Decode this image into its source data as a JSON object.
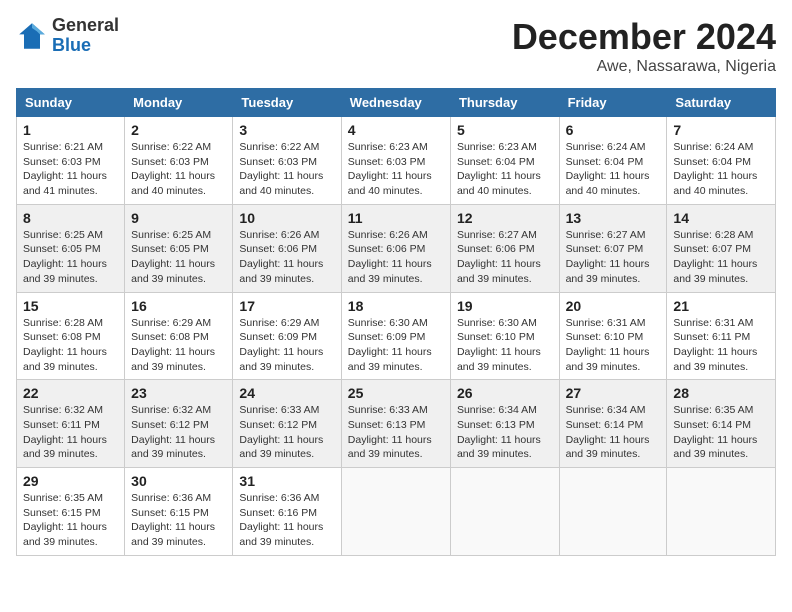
{
  "header": {
    "logo_general": "General",
    "logo_blue": "Blue",
    "month_title": "December 2024",
    "location": "Awe, Nassarawa, Nigeria"
  },
  "calendar": {
    "days_of_week": [
      "Sunday",
      "Monday",
      "Tuesday",
      "Wednesday",
      "Thursday",
      "Friday",
      "Saturday"
    ],
    "weeks": [
      [
        {
          "day": "",
          "info": ""
        },
        {
          "day": "",
          "info": ""
        },
        {
          "day": "",
          "info": ""
        },
        {
          "day": "",
          "info": ""
        },
        {
          "day": "",
          "info": ""
        },
        {
          "day": "",
          "info": ""
        },
        {
          "day": "",
          "info": ""
        }
      ]
    ]
  },
  "cells": {
    "w1": [
      {
        "num": "1",
        "rise": "Sunrise: 6:21 AM",
        "set": "Sunset: 6:03 PM",
        "daylight": "Daylight: 11 hours and 41 minutes."
      },
      {
        "num": "2",
        "rise": "Sunrise: 6:22 AM",
        "set": "Sunset: 6:03 PM",
        "daylight": "Daylight: 11 hours and 40 minutes."
      },
      {
        "num": "3",
        "rise": "Sunrise: 6:22 AM",
        "set": "Sunset: 6:03 PM",
        "daylight": "Daylight: 11 hours and 40 minutes."
      },
      {
        "num": "4",
        "rise": "Sunrise: 6:23 AM",
        "set": "Sunset: 6:03 PM",
        "daylight": "Daylight: 11 hours and 40 minutes."
      },
      {
        "num": "5",
        "rise": "Sunrise: 6:23 AM",
        "set": "Sunset: 6:04 PM",
        "daylight": "Daylight: 11 hours and 40 minutes."
      },
      {
        "num": "6",
        "rise": "Sunrise: 6:24 AM",
        "set": "Sunset: 6:04 PM",
        "daylight": "Daylight: 11 hours and 40 minutes."
      },
      {
        "num": "7",
        "rise": "Sunrise: 6:24 AM",
        "set": "Sunset: 6:04 PM",
        "daylight": "Daylight: 11 hours and 40 minutes."
      }
    ],
    "w2": [
      {
        "num": "8",
        "rise": "Sunrise: 6:25 AM",
        "set": "Sunset: 6:05 PM",
        "daylight": "Daylight: 11 hours and 39 minutes."
      },
      {
        "num": "9",
        "rise": "Sunrise: 6:25 AM",
        "set": "Sunset: 6:05 PM",
        "daylight": "Daylight: 11 hours and 39 minutes."
      },
      {
        "num": "10",
        "rise": "Sunrise: 6:26 AM",
        "set": "Sunset: 6:06 PM",
        "daylight": "Daylight: 11 hours and 39 minutes."
      },
      {
        "num": "11",
        "rise": "Sunrise: 6:26 AM",
        "set": "Sunset: 6:06 PM",
        "daylight": "Daylight: 11 hours and 39 minutes."
      },
      {
        "num": "12",
        "rise": "Sunrise: 6:27 AM",
        "set": "Sunset: 6:06 PM",
        "daylight": "Daylight: 11 hours and 39 minutes."
      },
      {
        "num": "13",
        "rise": "Sunrise: 6:27 AM",
        "set": "Sunset: 6:07 PM",
        "daylight": "Daylight: 11 hours and 39 minutes."
      },
      {
        "num": "14",
        "rise": "Sunrise: 6:28 AM",
        "set": "Sunset: 6:07 PM",
        "daylight": "Daylight: 11 hours and 39 minutes."
      }
    ],
    "w3": [
      {
        "num": "15",
        "rise": "Sunrise: 6:28 AM",
        "set": "Sunset: 6:08 PM",
        "daylight": "Daylight: 11 hours and 39 minutes."
      },
      {
        "num": "16",
        "rise": "Sunrise: 6:29 AM",
        "set": "Sunset: 6:08 PM",
        "daylight": "Daylight: 11 hours and 39 minutes."
      },
      {
        "num": "17",
        "rise": "Sunrise: 6:29 AM",
        "set": "Sunset: 6:09 PM",
        "daylight": "Daylight: 11 hours and 39 minutes."
      },
      {
        "num": "18",
        "rise": "Sunrise: 6:30 AM",
        "set": "Sunset: 6:09 PM",
        "daylight": "Daylight: 11 hours and 39 minutes."
      },
      {
        "num": "19",
        "rise": "Sunrise: 6:30 AM",
        "set": "Sunset: 6:10 PM",
        "daylight": "Daylight: 11 hours and 39 minutes."
      },
      {
        "num": "20",
        "rise": "Sunrise: 6:31 AM",
        "set": "Sunset: 6:10 PM",
        "daylight": "Daylight: 11 hours and 39 minutes."
      },
      {
        "num": "21",
        "rise": "Sunrise: 6:31 AM",
        "set": "Sunset: 6:11 PM",
        "daylight": "Daylight: 11 hours and 39 minutes."
      }
    ],
    "w4": [
      {
        "num": "22",
        "rise": "Sunrise: 6:32 AM",
        "set": "Sunset: 6:11 PM",
        "daylight": "Daylight: 11 hours and 39 minutes."
      },
      {
        "num": "23",
        "rise": "Sunrise: 6:32 AM",
        "set": "Sunset: 6:12 PM",
        "daylight": "Daylight: 11 hours and 39 minutes."
      },
      {
        "num": "24",
        "rise": "Sunrise: 6:33 AM",
        "set": "Sunset: 6:12 PM",
        "daylight": "Daylight: 11 hours and 39 minutes."
      },
      {
        "num": "25",
        "rise": "Sunrise: 6:33 AM",
        "set": "Sunset: 6:13 PM",
        "daylight": "Daylight: 11 hours and 39 minutes."
      },
      {
        "num": "26",
        "rise": "Sunrise: 6:34 AM",
        "set": "Sunset: 6:13 PM",
        "daylight": "Daylight: 11 hours and 39 minutes."
      },
      {
        "num": "27",
        "rise": "Sunrise: 6:34 AM",
        "set": "Sunset: 6:14 PM",
        "daylight": "Daylight: 11 hours and 39 minutes."
      },
      {
        "num": "28",
        "rise": "Sunrise: 6:35 AM",
        "set": "Sunset: 6:14 PM",
        "daylight": "Daylight: 11 hours and 39 minutes."
      }
    ],
    "w5": [
      {
        "num": "29",
        "rise": "Sunrise: 6:35 AM",
        "set": "Sunset: 6:15 PM",
        "daylight": "Daylight: 11 hours and 39 minutes."
      },
      {
        "num": "30",
        "rise": "Sunrise: 6:36 AM",
        "set": "Sunset: 6:15 PM",
        "daylight": "Daylight: 11 hours and 39 minutes."
      },
      {
        "num": "31",
        "rise": "Sunrise: 6:36 AM",
        "set": "Sunset: 6:16 PM",
        "daylight": "Daylight: 11 hours and 39 minutes."
      },
      {
        "num": "",
        "rise": "",
        "set": "",
        "daylight": ""
      },
      {
        "num": "",
        "rise": "",
        "set": "",
        "daylight": ""
      },
      {
        "num": "",
        "rise": "",
        "set": "",
        "daylight": ""
      },
      {
        "num": "",
        "rise": "",
        "set": "",
        "daylight": ""
      }
    ]
  }
}
